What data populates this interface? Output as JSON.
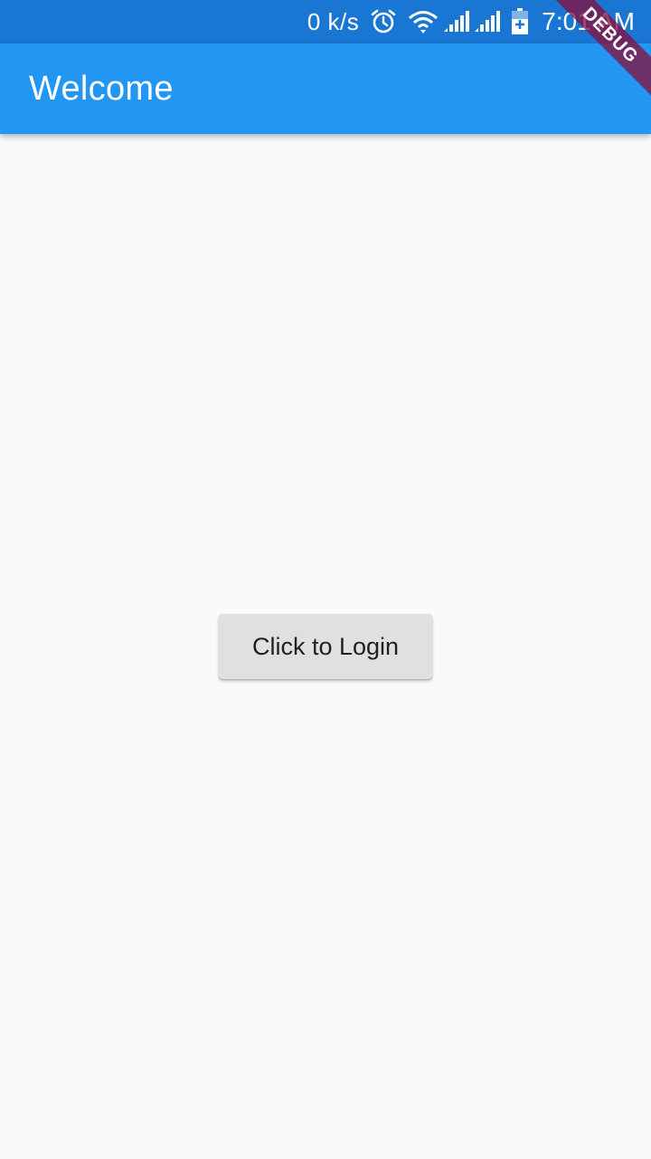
{
  "status_bar": {
    "net_speed": "0 k/s",
    "time": "7:01 AM",
    "icons": [
      "alarm-icon",
      "wifi-icon",
      "signal-icon",
      "signal-icon",
      "battery-charging-icon"
    ],
    "background_color": "#1976d2"
  },
  "app_bar": {
    "title": "Welcome",
    "background_color": "#2196f3"
  },
  "main": {
    "login_button_label": "Click to Login"
  },
  "debug_banner": {
    "label": "DEBUG"
  }
}
